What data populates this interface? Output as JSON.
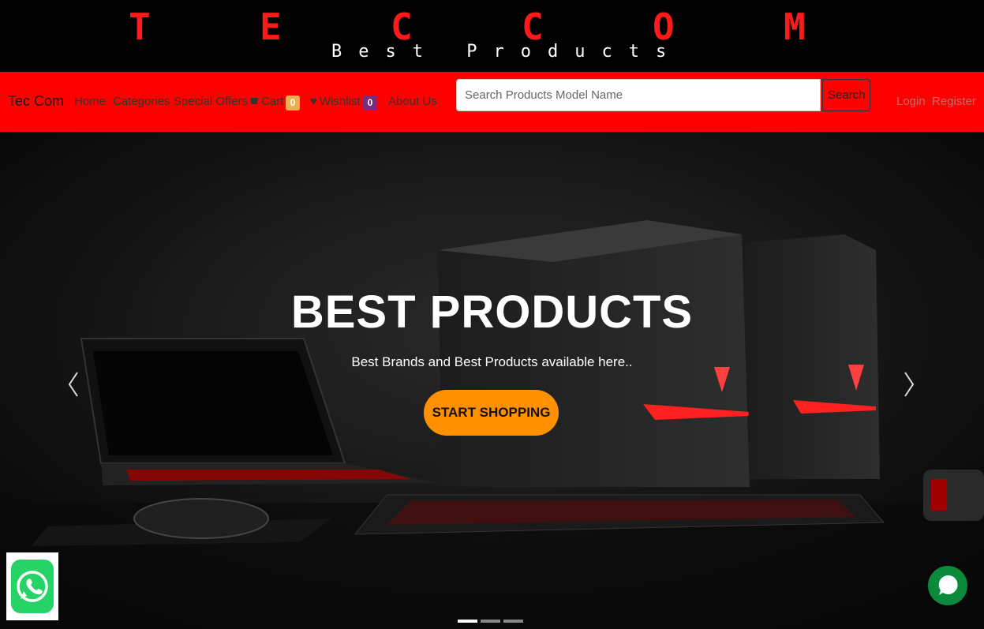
{
  "banner": {
    "letters": [
      "T",
      "E",
      "C",
      "C",
      "O",
      "M"
    ],
    "tagline": "Best Products",
    "letter_color": "#ff1a1a"
  },
  "navbar": {
    "brand": "Tec Com",
    "links": [
      "Home",
      "Categories",
      "Special Offers",
      "Cart",
      "Wishlist",
      "About Us"
    ],
    "cart_count": "0",
    "wishlist_count": "0",
    "search_placeholder": "Search Products Model Name",
    "search_button": "Search",
    "login": "Login",
    "register": "Register",
    "bg_color": "#ff0000"
  },
  "hero": {
    "title": "BEST PRODUCTS",
    "subtitle": "Best Brands and Best Products available here..",
    "cta": "START SHOPPING",
    "cta_color": "#ff9100",
    "prev_icon": "chevron-left-icon",
    "next_icon": "chevron-right-icon",
    "slides_total": 3,
    "active_slide": 1
  },
  "widgets": {
    "whatsapp_icon": "whatsapp-icon",
    "chat_icon": "chat-bubble-icon"
  }
}
